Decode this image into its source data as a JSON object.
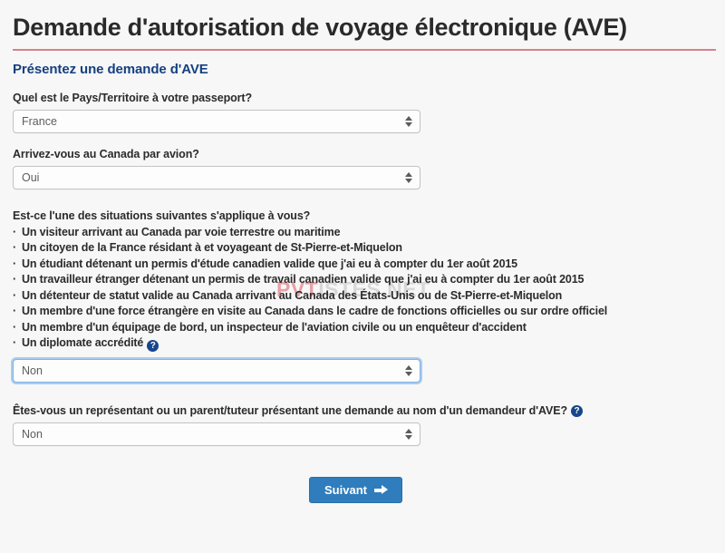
{
  "header": {
    "title": "Demande d'autorisation de voyage électronique (AVE)",
    "subtitle": "Présentez une demande d'AVE",
    "rule_color": "#d9808a",
    "subtitle_color": "#15407f"
  },
  "watermark": {
    "part_colored": "PVT",
    "part_gray": "ISTES.NET",
    "colored_hex": "#e8a0a6",
    "gray_hex": "#d8d8da"
  },
  "fields": {
    "country": {
      "label": "Quel est le Pays/Territoire à votre passeport?",
      "value": "France"
    },
    "by_air": {
      "label": "Arrivez-vous au Canada par avion?",
      "value": "Oui"
    },
    "situations": {
      "label": "Est-ce l'une des situations suivantes s'applique à vous?",
      "items": [
        "Un visiteur arrivant au Canada par voie terrestre ou maritime",
        "Un citoyen de la France résidant à et voyageant de St-Pierre-et-Miquelon",
        "Un étudiant détenant un permis d'étude canadien valide que j'ai eu à compter du 1er août 2015",
        "Un travailleur étranger détenant un permis de travail canadien valide que j'ai eu à compter du 1er août 2015",
        "Un détenteur de statut valide au Canada arrivant au Canada des États-Unis ou de St-Pierre-et-Miquelon",
        "Un membre d'une force étrangère en visite au Canada dans le cadre de fonctions officielles ou sur ordre officiel",
        "Un membre d'un équipage de bord, un inspecteur de l'aviation civile ou un enquêteur d'accident",
        "Un diplomate accrédité"
      ],
      "help_glyph": "?",
      "value": "Non",
      "focused": true
    },
    "representative": {
      "label": "Êtes-vous un représentant ou un parent/tuteur présentant une demande au nom d'un demandeur d'AVE?",
      "help_glyph": "?",
      "value": "Non"
    }
  },
  "actions": {
    "next_label": "Suivant",
    "next_color": "#2f7dbd"
  }
}
